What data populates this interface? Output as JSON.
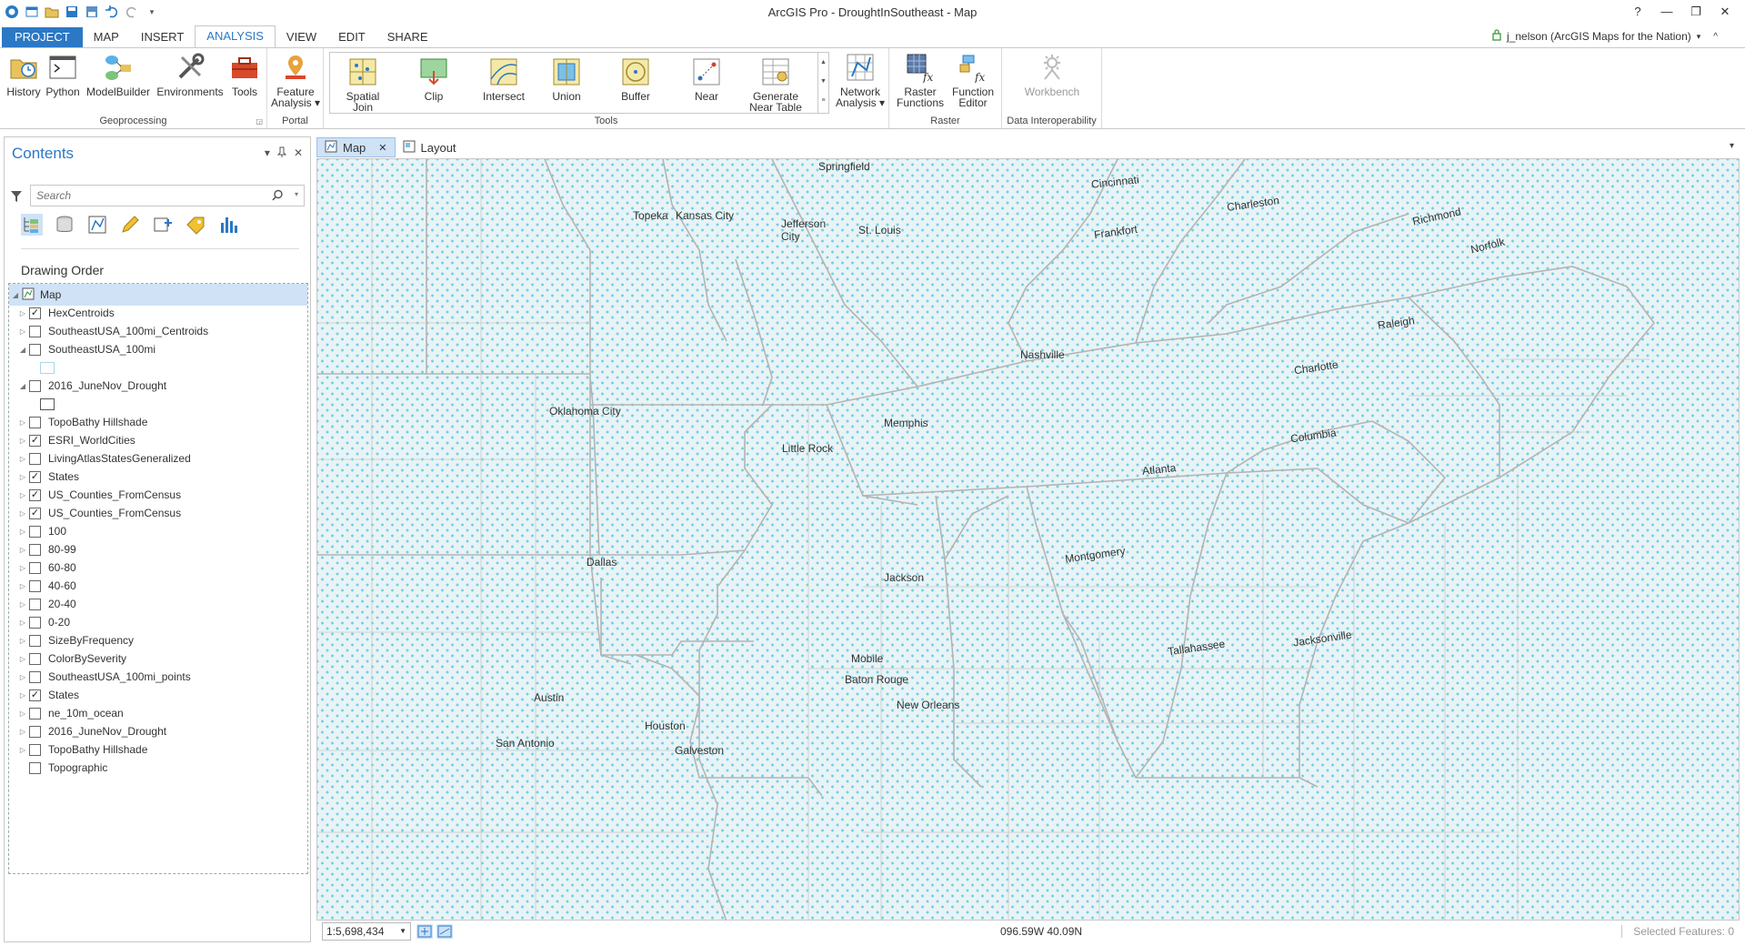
{
  "window": {
    "title": "ArcGIS Pro - DroughtInSoutheast - Map",
    "help": "?",
    "minimize": "—",
    "restore": "❐",
    "close": "✕"
  },
  "ribbon_tabs": [
    "PROJECT",
    "MAP",
    "INSERT",
    "ANALYSIS",
    "VIEW",
    "EDIT",
    "SHARE"
  ],
  "active_tab": "ANALYSIS",
  "user": {
    "label": "j_nelson (ArcGIS Maps for the Nation)",
    "caret": "▾",
    "collapse": "^"
  },
  "ribbon": {
    "geoprocessing": {
      "label": "Geoprocessing",
      "buttons": [
        "History",
        "Python",
        "ModelBuilder",
        "Environments",
        "Tools"
      ]
    },
    "portal": {
      "label": "Portal",
      "feature_analysis_line1": "Feature",
      "feature_analysis_line2": "Analysis ▾"
    },
    "tools": {
      "label": "Tools",
      "spatial_join_line1": "Spatial",
      "spatial_join_line2": "Join",
      "clip": "Clip",
      "intersect": "Intersect",
      "union": "Union",
      "buffer": "Buffer",
      "near": "Near",
      "generate_line1": "Generate",
      "generate_line2": "Near Table",
      "network_line1": "Network",
      "network_line2": "Analysis ▾"
    },
    "raster": {
      "label": "Raster",
      "raster_fn_line1": "Raster",
      "raster_fn_line2": "Functions",
      "fn_editor_line1": "Function",
      "fn_editor_line2": "Editor"
    },
    "interop": {
      "label": "Data Interoperability",
      "workbench": "Workbench"
    }
  },
  "contents": {
    "title": "Contents",
    "search_placeholder": "Search",
    "drawing_order": "Drawing Order",
    "layers": [
      {
        "name": "Map",
        "checked": null,
        "expander": "◢"
      },
      {
        "name": "HexCentroids",
        "checked": true,
        "expander": "▷"
      },
      {
        "name": "SoutheastUSA_100mi_Centroids",
        "checked": false,
        "expander": "▷"
      },
      {
        "name": "SoutheastUSA_100mi",
        "checked": false,
        "expander": "◢"
      },
      {
        "name": "2016_JuneNov_Drought",
        "checked": false,
        "expander": "◢"
      },
      {
        "name": "TopoBathy Hillshade",
        "checked": false,
        "expander": "▷"
      },
      {
        "name": "ESRI_WorldCities",
        "checked": true,
        "expander": "▷"
      },
      {
        "name": "LivingAtlasStatesGeneralized",
        "checked": false,
        "expander": "▷"
      },
      {
        "name": "States",
        "checked": true,
        "expander": "▷"
      },
      {
        "name": "US_Counties_FromCensus",
        "checked": true,
        "expander": "▷"
      },
      {
        "name": "US_Counties_FromCensus",
        "checked": true,
        "expander": "▷"
      },
      {
        "name": "100",
        "checked": false,
        "expander": "▷"
      },
      {
        "name": "80-99",
        "checked": false,
        "expander": "▷"
      },
      {
        "name": "60-80",
        "checked": false,
        "expander": "▷"
      },
      {
        "name": "40-60",
        "checked": false,
        "expander": "▷"
      },
      {
        "name": "20-40",
        "checked": false,
        "expander": "▷"
      },
      {
        "name": "0-20",
        "checked": false,
        "expander": "▷"
      },
      {
        "name": "SizeByFrequency",
        "checked": false,
        "expander": "▷"
      },
      {
        "name": "ColorBySeverity",
        "checked": false,
        "expander": "▷"
      },
      {
        "name": "SoutheastUSA_100mi_points",
        "checked": false,
        "expander": "▷"
      },
      {
        "name": "States",
        "checked": true,
        "expander": "▷"
      },
      {
        "name": "ne_10m_ocean",
        "checked": false,
        "expander": "▷"
      },
      {
        "name": "2016_JuneNov_Drought",
        "checked": false,
        "expander": "▷"
      },
      {
        "name": "TopoBathy Hillshade",
        "checked": false,
        "expander": "▷"
      },
      {
        "name": "Topographic",
        "checked": false,
        "expander": ""
      }
    ]
  },
  "map_tabs": {
    "map": "Map",
    "layout": "Layout",
    "close": "✕"
  },
  "cities": [
    "Springfield",
    "Cincinnati",
    "Topeka",
    "Kansas City",
    "Jefferson\nCity",
    "St. Louis",
    "Charleston",
    "Frankfort",
    "Richmond",
    "Norfolk",
    "Raleigh",
    "Nashville",
    "Oklahoma City",
    "Memphis",
    "Charlotte",
    "Little Rock",
    "Columbia",
    "Atlanta",
    "Dallas",
    "Jackson",
    "Montgomery",
    "Mobile",
    "Tallahassee",
    "Jacksonville",
    "Baton Rouge",
    "New Orleans",
    "Austin",
    "Houston",
    "San Antonio",
    "Galveston"
  ],
  "status": {
    "scale": "1:5,698,434",
    "coordinates": "096.59W 40.09N",
    "selected_features": "Selected Features: 0"
  },
  "colors": {
    "accent": "#2b78c5",
    "hex_dots": "#6fd0ea",
    "map_bg": "#e8f3f5",
    "boundaries": "#b4b4b4"
  }
}
